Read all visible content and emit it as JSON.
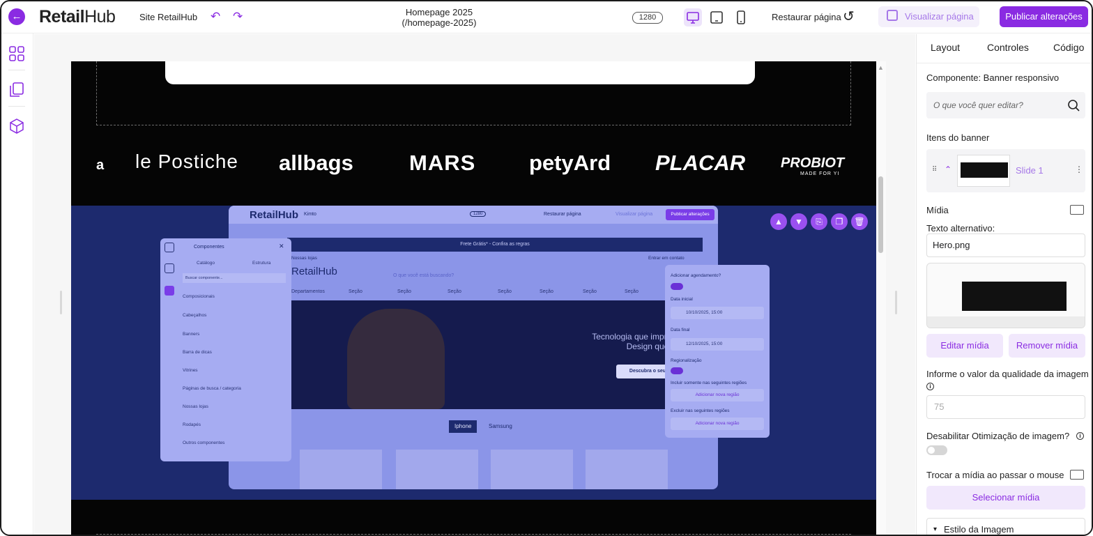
{
  "header": {
    "back_icon": "back-arrow-icon",
    "logo_bold": "Retail",
    "logo_light": "Hub",
    "site_label": "Site RetailHub",
    "page_title": "Homepage 2025",
    "page_slug": "(/homepage-2025)",
    "width_badge": "1280",
    "restore_label": "Restaurar página",
    "preview_label": "Visualizar página",
    "publish_label": "Publicar alterações",
    "accent_color": "#8a2be2"
  },
  "left_rail": {
    "icons": [
      "layout-grid-icon",
      "pages-icon",
      "cube-icon"
    ]
  },
  "canvas": {
    "brands": [
      "a",
      "le Postiche",
      "allbags",
      "MARS",
      "petyArd",
      "PLACAR",
      "PROBIOT"
    ],
    "brand_sub": "MADE FOR YI",
    "toolbar_icons": [
      "arrow-up-icon",
      "arrow-down-icon",
      "bookmark-icon",
      "duplicate-icon",
      "trash-icon"
    ]
  },
  "inner_screenshot": {
    "logo": "RetailHub",
    "site": "Kimto",
    "badge": "1280",
    "restore": "Restaurar página",
    "preview": "Visualizar página",
    "publish": "Publicar alterações",
    "announcement": "Frete Grátis* - Confira as regras",
    "store_link": "Nossas lojas",
    "login_link": "Entrar em contato",
    "logo2": "RetailHub",
    "search_placeholder": "O que você está buscando?",
    "departments": [
      "Departamentos",
      "Seção",
      "Seção",
      "Seção",
      "Seção",
      "Seção",
      "Seção",
      "Seção"
    ],
    "hero_line1": "Tecnologia que impressiona",
    "hero_line2": "Design que inspira",
    "hero_button": "Descubra o seu",
    "tabs": [
      "Iphone",
      "Samsung"
    ]
  },
  "components_panel": {
    "title": "Componentes",
    "tabs": [
      "Catálogo",
      "Estrutura"
    ],
    "search": "Buscar componente...",
    "items": [
      "Composicionais",
      "Cabeçalhos",
      "Banners",
      "Barra de dicas",
      "Vitrines",
      "Páginas de busca / categoria",
      "Nossas lojas",
      "Rodapés",
      "Outros componentes"
    ]
  },
  "schedule_panel": {
    "scheduling_label": "Adicionar agendamento?",
    "start_label": "Data inicial",
    "start_value": "10/10/2025, 15:00",
    "end_label": "Data final",
    "end_value": "12/10/2025, 15:00",
    "regional_label": "Regionalização",
    "include_label": "Incluir somente nas seguintes regiões",
    "add_region": "Adicionar nova região",
    "exclude_label": "Excluir nas seguintes regiões",
    "add_region2": "Adicionar nova região"
  },
  "right_panel": {
    "tabs": [
      "Layout",
      "Controles",
      "Código"
    ],
    "component_label": "Componente: Banner responsivo",
    "search_placeholder": "O que você quer editar?",
    "banner_items_label": "Itens do banner",
    "slide_name": "Slide 1",
    "media_label": "Mídia",
    "alt_label": "Texto alternativo:",
    "alt_value": "Hero.png",
    "edit_media": "Editar mídia",
    "remove_media": "Remover mídia",
    "quality_label": "Informe o valor da qualidade da imagem",
    "quality_value": "75",
    "disable_opt_label": "Desabilitar Otimização de imagem?",
    "hover_label": "Trocar a mídia ao passar o mouse",
    "select_media": "Selecionar mídia",
    "image_style": "Estilo da Imagem"
  }
}
